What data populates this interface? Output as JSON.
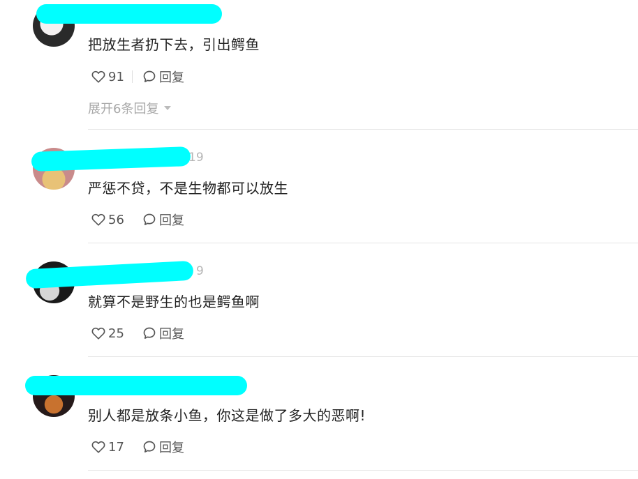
{
  "comments": [
    {
      "text": "把放生者扔下去，引出鳄鱼",
      "likes": "91",
      "reply_label": "回复",
      "date_fragment": "",
      "expand_label": "展开6条回复"
    },
    {
      "text": "严惩不贷，不是生物都可以放生",
      "likes": "56",
      "reply_label": "回复",
      "date_fragment": "19"
    },
    {
      "text": "就算不是野生的也是鳄鱼啊",
      "likes": "25",
      "reply_label": "回复",
      "date_fragment": "9"
    },
    {
      "text": "别人都是放条小鱼，你这是做了多大的恶啊!",
      "likes": "17",
      "reply_label": "回复",
      "date_fragment": ""
    }
  ],
  "icons": {
    "like": "heart-outline-icon",
    "reply": "speech-bubble-icon",
    "expand": "caret-down-icon"
  },
  "colors": {
    "redaction": "#00ffff",
    "text": "#222222",
    "muted": "#a8a8a8"
  }
}
